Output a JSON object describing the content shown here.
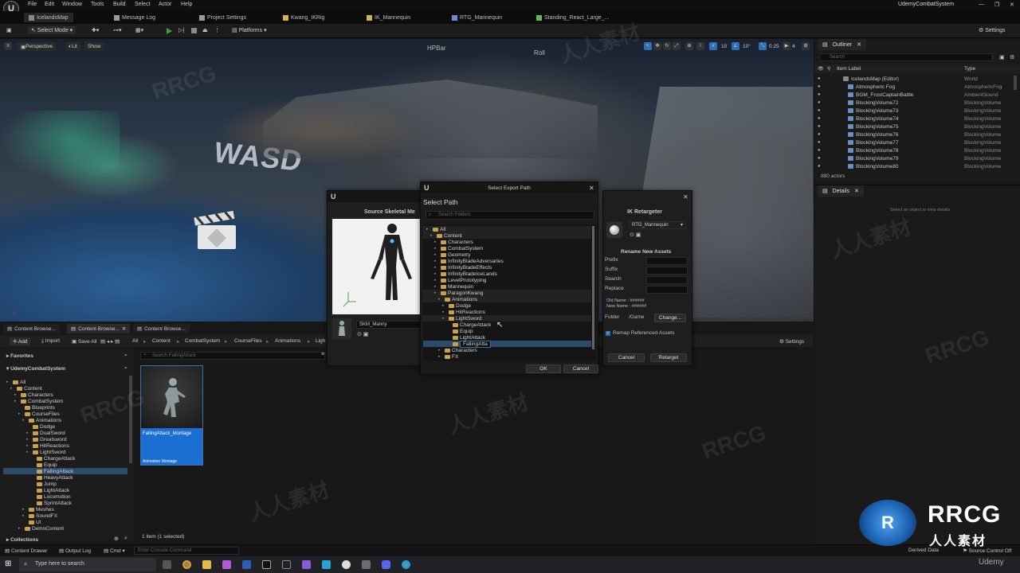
{
  "app": {
    "menu": [
      "File",
      "Edit",
      "Window",
      "Tools",
      "Build",
      "Select",
      "Actor",
      "Help"
    ],
    "project_name": "UdemyCombatSystem",
    "logo_text": "U"
  },
  "doc_tabs": [
    {
      "label": "IcelandsMap"
    },
    {
      "label": "Message Log"
    },
    {
      "label": "Project Settings"
    },
    {
      "label": "Kwang_IKRig"
    },
    {
      "label": "IK_Mannequin"
    },
    {
      "label": "RTG_Mannequin"
    },
    {
      "label": "Standing_React_Large_..."
    }
  ],
  "toolbar": {
    "select_mode": "Select Mode",
    "platforms": "Platforms",
    "settings": "Settings"
  },
  "viewport": {
    "perspective": "Perspective",
    "lit": "Lit",
    "show": "Show",
    "wasd": "WASD",
    "label_hpbar": "HPBar",
    "label_roll": "Roll",
    "grid_value": "10",
    "angle_value": "10°",
    "scale_value": "0.25",
    "camera_value": "4"
  },
  "outliner": {
    "tab": "Outliner",
    "search_placeholder": "Search",
    "col_label": "Item Label",
    "col_type": "Type",
    "rows": [
      {
        "label": "IcelandsMap (Editor)",
        "type": "World"
      },
      {
        "label": "Atmospheric Fog",
        "type": "AtmosphericFog"
      },
      {
        "label": "BGM_FrostCaptainBattle",
        "type": "AmbientSound"
      },
      {
        "label": "BlockingVolume72",
        "type": "BlockingVolume"
      },
      {
        "label": "BlockingVolume73",
        "type": "BlockingVolume"
      },
      {
        "label": "BlockingVolume74",
        "type": "BlockingVolume"
      },
      {
        "label": "BlockingVolume75",
        "type": "BlockingVolume"
      },
      {
        "label": "BlockingVolume76",
        "type": "BlockingVolume"
      },
      {
        "label": "BlockingVolume77",
        "type": "BlockingVolume"
      },
      {
        "label": "BlockingVolume78",
        "type": "BlockingVolume"
      },
      {
        "label": "BlockingVolume79",
        "type": "BlockingVolume"
      },
      {
        "label": "BlockingVolume80",
        "type": "BlockingVolume"
      }
    ],
    "actor_count": "880 actors"
  },
  "details": {
    "tab": "Details",
    "empty_hint": "Select an object to view details"
  },
  "content_browser": {
    "tabs": [
      "Content Browse...",
      "Content Browse...",
      "Content Browse..."
    ],
    "add": "Add",
    "import": "Import",
    "save_all": "Save All",
    "breadcrumb": [
      "All",
      "Content",
      "CombatSystem",
      "CourseFiles",
      "Animations",
      "Ligh"
    ],
    "settings": "Settings",
    "favorites": "Favorites",
    "project": "UdemyCombatSystem",
    "search_placeholder": "Search FallingAttack",
    "tree": [
      {
        "label": "All",
        "indent": 0
      },
      {
        "label": "Content",
        "indent": 1
      },
      {
        "label": "Characters",
        "indent": 2
      },
      {
        "label": "CombatSystem",
        "indent": 2
      },
      {
        "label": "Blueprints",
        "indent": 3
      },
      {
        "label": "CourseFiles",
        "indent": 3
      },
      {
        "label": "Animations",
        "indent": 4
      },
      {
        "label": "Dodge",
        "indent": 5
      },
      {
        "label": "DualSword",
        "indent": 5
      },
      {
        "label": "Greatsword",
        "indent": 5
      },
      {
        "label": "HitReactions",
        "indent": 5
      },
      {
        "label": "LightSword",
        "indent": 5
      },
      {
        "label": "ChargeAttack",
        "indent": 6
      },
      {
        "label": "Equip",
        "indent": 6
      },
      {
        "label": "FallingAttack",
        "indent": 6
      },
      {
        "label": "HeavyAttack",
        "indent": 6
      },
      {
        "label": "Jump",
        "indent": 6
      },
      {
        "label": "LightAttack",
        "indent": 6
      },
      {
        "label": "Locomotion",
        "indent": 6
      },
      {
        "label": "SprintAttack",
        "indent": 6
      },
      {
        "label": "Meshes",
        "indent": 4
      },
      {
        "label": "SoundFX",
        "indent": 4
      },
      {
        "label": "UI",
        "indent": 4
      },
      {
        "label": "DemoContent",
        "indent": 3
      }
    ],
    "asset_name": "FallingAttack_Montage",
    "asset_type": "Animation Montage",
    "collections": "Collections",
    "item_count": "1 item (1 selected)"
  },
  "source_dialog": {
    "title": "Source Skeletal Me",
    "mesh_name": "SKM_Manny"
  },
  "export_dialog": {
    "title": "Select Export Path",
    "heading": "Select Path",
    "search_placeholder": "Search Folders",
    "tree": [
      {
        "label": "All",
        "indent": 0
      },
      {
        "label": "Content",
        "indent": 1
      },
      {
        "label": "Characters",
        "indent": 2
      },
      {
        "label": "CombatSystem",
        "indent": 2
      },
      {
        "label": "Geometry",
        "indent": 2
      },
      {
        "label": "InfinityBladeAdversaries",
        "indent": 2
      },
      {
        "label": "InfinityBladeEffects",
        "indent": 2
      },
      {
        "label": "InfinityBladeIceLands",
        "indent": 2
      },
      {
        "label": "LevelPrototyping",
        "indent": 2
      },
      {
        "label": "Mannequin",
        "indent": 2
      },
      {
        "label": "ParagonKwang",
        "indent": 2
      },
      {
        "label": "Animations",
        "indent": 3
      },
      {
        "label": "Dodge",
        "indent": 4
      },
      {
        "label": "HitReactions",
        "indent": 4
      },
      {
        "label": "LightSword",
        "indent": 4
      },
      {
        "label": "ChargeAttack",
        "indent": 5
      },
      {
        "label": "Equip",
        "indent": 5
      },
      {
        "label": "LightAttack",
        "indent": 5
      },
      {
        "label": "FallingAtta",
        "indent": 5
      },
      {
        "label": "Characters",
        "indent": 3
      },
      {
        "label": "FX",
        "indent": 3
      }
    ],
    "ok": "OK",
    "cancel": "Cancel"
  },
  "retarget_dialog": {
    "title": "IK Retargeter",
    "retargeter": "RTG_Mannequin",
    "rename_heading": "Rename New Assets",
    "prefix": "Prefix",
    "suffix": "Suffix",
    "search": "Search",
    "replace": "Replace",
    "old_name": "Old Name : ######",
    "new_name": "New Name : ######",
    "folder_label": "Folder",
    "folder_value": "/Game",
    "change": "Change...",
    "remap": "Remap Referenced Assets",
    "cancel": "Cancel",
    "retarget": "Retarget"
  },
  "statusbar": {
    "content_drawer": "Content Drawer",
    "output_log": "Output Log",
    "cmd": "Cmd",
    "console_placeholder": "Enter Console Command",
    "derived_data": "Derived Data",
    "source_control": "Source Control Off"
  },
  "taskbar": {
    "search_placeholder": "Type here to search"
  },
  "watermarks": {
    "brand": "RRCG",
    "cn": "人人素材",
    "udemy": "Udemy"
  },
  "colors": {
    "accent_blue": "#2f6fb7",
    "play_green": "#3ca33c",
    "folder": "#c9a14a",
    "selection": "#2e4a6b"
  }
}
